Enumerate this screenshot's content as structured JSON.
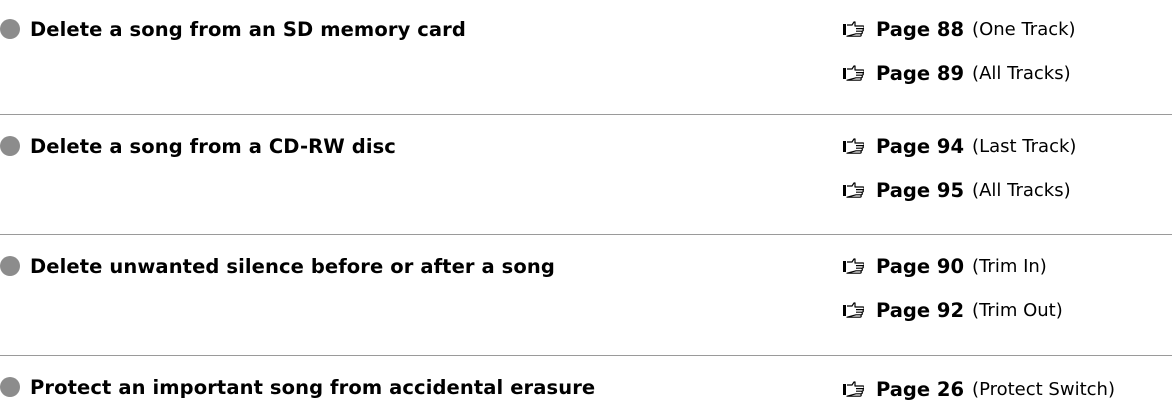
{
  "colors": {
    "bullet": "#8c8c8c",
    "divider": "#9a9a9a",
    "text": "#000000"
  },
  "rows": [
    {
      "task": "Delete a song from an SD memory card",
      "refs": [
        {
          "page": "Page 88",
          "note": "(One Track)",
          "icon": "pointing-hand-icon"
        },
        {
          "page": "Page 89",
          "note": "(All Tracks)",
          "icon": "pointing-hand-icon"
        }
      ]
    },
    {
      "task": "Delete a song from a CD-RW disc",
      "refs": [
        {
          "page": "Page 94",
          "note": "(Last Track)",
          "icon": "pointing-hand-icon"
        },
        {
          "page": "Page 95",
          "note": "(All Tracks)",
          "icon": "pointing-hand-icon"
        }
      ]
    },
    {
      "task": "Delete unwanted silence before or after a song",
      "refs": [
        {
          "page": "Page 90",
          "note": "(Trim In)",
          "icon": "pointing-hand-icon"
        },
        {
          "page": "Page 92",
          "note": "(Trim Out)",
          "icon": "pointing-hand-icon"
        }
      ]
    },
    {
      "task": "Protect an important song from accidental erasure",
      "refs": [
        {
          "page": "Page 26",
          "note": "(Protect Switch)",
          "icon": "pointing-hand-icon"
        }
      ]
    }
  ]
}
